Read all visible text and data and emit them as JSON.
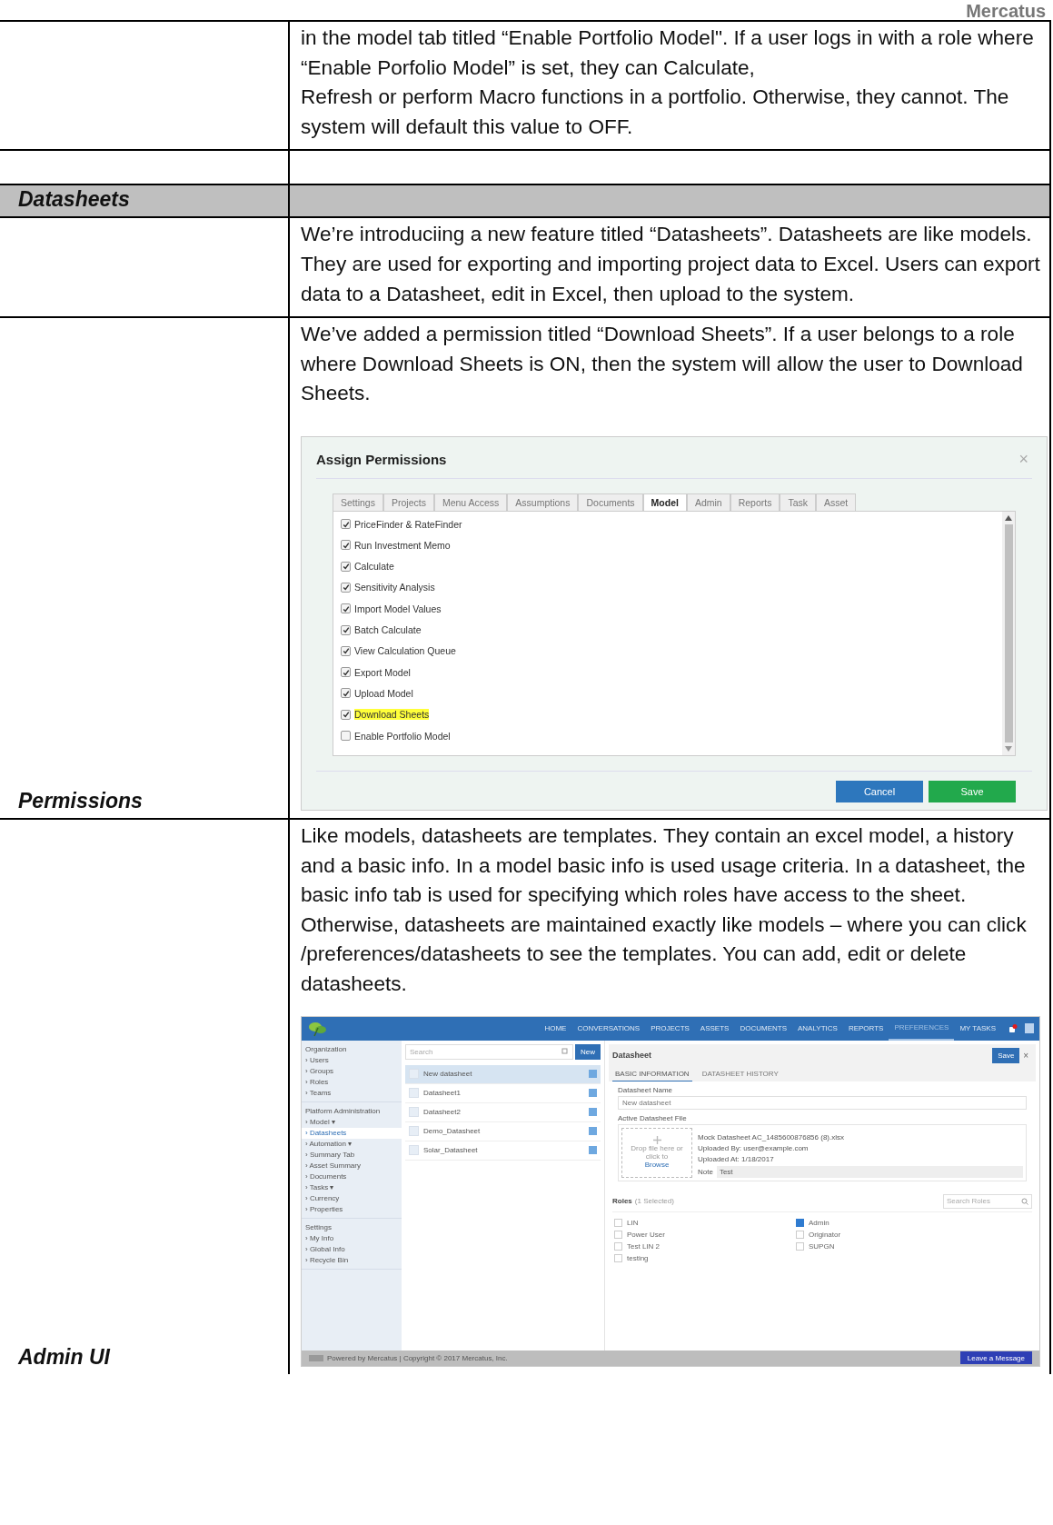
{
  "logo": {
    "text": "Mercatus"
  },
  "rows": [
    {
      "kind": "text",
      "paragraphs": [
        "in the model tab titled “Enable Portfolio Model\". If a user logs in with a role where “Enable Porfolio Model” is set, they can Calculate,\nRefresh or perform Macro functions in a portfolio.  Otherwise, they cannot.  The system will default this value to OFF."
      ]
    },
    {
      "kind": "blank"
    },
    {
      "kind": "section",
      "label": "Datasheets"
    },
    {
      "kind": "text",
      "paragraphs": [
        "We’re introduciing a new feature titled “Datasheets”.  Datasheets are like models.  They are used for exporting and importing project data to Excel.  Users can export data to a Datasheet, edit in Excel, then upload to the system."
      ]
    },
    {
      "kind": "permissions",
      "label": "Permissions",
      "paragraphs": [
        "We’ve added a permission titled “Download Sheets”.  If a user belongs to a role where Download Sheets is ON, then the system will allow the user to Download Sheets."
      ],
      "dialog": {
        "title": "Assign Permissions",
        "close": "×",
        "tabs": [
          {
            "label": "Settings",
            "selected": false
          },
          {
            "label": "Projects",
            "selected": false
          },
          {
            "label": "Menu Access",
            "selected": false
          },
          {
            "label": "Assumptions",
            "selected": false
          },
          {
            "label": "Documents",
            "selected": false
          },
          {
            "label": "Model",
            "selected": true
          },
          {
            "label": "Admin",
            "selected": false
          },
          {
            "label": "Reports",
            "selected": false
          },
          {
            "label": "Task",
            "selected": false
          },
          {
            "label": "Asset",
            "selected": false
          }
        ],
        "items": [
          {
            "label": "PriceFinder & RateFinder",
            "checked": true,
            "highlighted": false
          },
          {
            "label": "Run Investment Memo",
            "checked": true,
            "highlighted": false
          },
          {
            "label": "Calculate",
            "checked": true,
            "highlighted": false
          },
          {
            "label": "Sensitivity Analysis",
            "checked": true,
            "highlighted": false
          },
          {
            "label": "Import Model Values",
            "checked": true,
            "highlighted": false
          },
          {
            "label": "Batch Calculate",
            "checked": true,
            "highlighted": false
          },
          {
            "label": "View Calculation Queue",
            "checked": true,
            "highlighted": false
          },
          {
            "label": "Export Model",
            "checked": true,
            "highlighted": false
          },
          {
            "label": "Upload Model",
            "checked": true,
            "highlighted": false
          },
          {
            "label": "Download Sheets",
            "checked": true,
            "highlighted": true
          },
          {
            "label": "Enable Portfolio Model",
            "checked": false,
            "highlighted": false
          }
        ],
        "buttons": [
          {
            "label": "Cancel",
            "kind": "secondary"
          },
          {
            "label": "Save",
            "kind": "primary"
          }
        ]
      }
    },
    {
      "kind": "admin",
      "label": "Admin UI",
      "paragraphs": [
        "Like models, datasheets are templates.  They contain an excel model, a history and a basic info.  In a model basic info is used usage criteria.  In a datasheet, the basic info tab is used for specifying which roles have access to the sheet.  Otherwise, datasheets are maintained exactly like models – where you can click /preferences/datasheets to see the templates.  You can add, edit or delete datasheets."
      ],
      "app": {
        "nav": [
          {
            "label": "HOME",
            "selected": false
          },
          {
            "label": "CONVERSATIONS",
            "selected": false
          },
          {
            "label": "PROJECTS",
            "selected": false
          },
          {
            "label": "ASSETS",
            "selected": false
          },
          {
            "label": "DOCUMENTS",
            "selected": false
          },
          {
            "label": "ANALYTICS",
            "selected": false
          },
          {
            "label": "REPORTS",
            "selected": false
          },
          {
            "label": "PREFERENCES",
            "selected": true
          },
          {
            "label": "MY TASKS",
            "selected": false
          }
        ],
        "sidebar": [
          {
            "heading": "Organization",
            "items": [
              {
                "label": "› Users",
                "selected": false
              },
              {
                "label": "› Groups",
                "selected": false
              },
              {
                "label": "› Roles",
                "selected": false
              },
              {
                "label": "› Teams",
                "selected": false
              }
            ]
          },
          {
            "heading": "Platform Administration",
            "items": [
              {
                "label": "› Model ▾",
                "selected": false
              },
              {
                "label": "› Datasheets",
                "selected": true
              },
              {
                "label": "› Automation ▾",
                "selected": false
              },
              {
                "label": "› Summary Tab",
                "selected": false
              },
              {
                "label": "› Asset Summary",
                "selected": false
              },
              {
                "label": "› Documents",
                "selected": false
              },
              {
                "label": "› Tasks ▾",
                "selected": false
              },
              {
                "label": "› Currency",
                "selected": false
              },
              {
                "label": "› Properties",
                "selected": false
              }
            ]
          },
          {
            "heading": "Settings",
            "items": [
              {
                "label": "› My Info",
                "selected": false
              },
              {
                "label": "› Global Info",
                "selected": false
              },
              {
                "label": "› Recycle Bin",
                "selected": false
              }
            ]
          }
        ],
        "search": {
          "placeholder": "Search"
        },
        "new_button": "New",
        "list": [
          {
            "label": "New datasheet",
            "selected": true
          },
          {
            "label": "Datasheet1",
            "selected": false
          },
          {
            "label": "Datasheet2",
            "selected": false
          },
          {
            "label": "Demo_Datasheet",
            "selected": false
          },
          {
            "label": "Solar_Datasheet",
            "selected": false
          }
        ],
        "detail": {
          "title": "Datasheet",
          "save": "Save",
          "close": "×",
          "tabs": [
            {
              "label": "BASIC INFORMATION",
              "selected": true
            },
            {
              "label": "DATASHEET HISTORY",
              "selected": false
            }
          ],
          "name_label": "Datasheet Name",
          "name_value": "New datasheet",
          "file_label": "Active Datasheet File",
          "drop_text": "Drop file here or click to",
          "browse": "Browse",
          "file_lines": [
            "Mock Datasheet AC_1485600876856 (8).xlsx",
            "Uploaded By: user@example.com",
            "Uploaded At: 1/18/2017"
          ],
          "note_label": "Note",
          "note_value": "Test",
          "roles_label": "Roles",
          "roles_count": "(1 Selected)",
          "roles_search": "Search Roles",
          "roles": [
            {
              "label": "LIN",
              "checked": false
            },
            {
              "label": "Power User",
              "checked": false
            },
            {
              "label": "Test LIN 2",
              "checked": false
            },
            {
              "label": "testing",
              "checked": false
            },
            {
              "label": "Admin",
              "checked": true
            },
            {
              "label": "Originator",
              "checked": false
            },
            {
              "label": "SUPGN",
              "checked": false
            }
          ]
        },
        "footer": "Powered by Mercatus | Copyright © 2017 Mercatus, Inc.",
        "message_button": "Leave a Message"
      }
    }
  ]
}
